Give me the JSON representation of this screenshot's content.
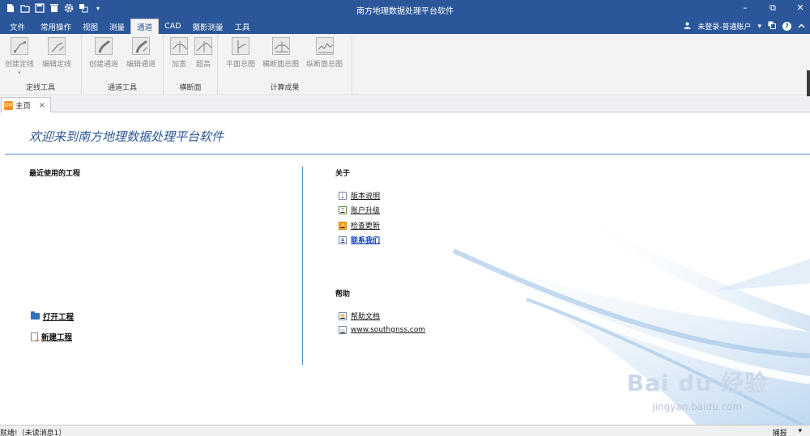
{
  "window": {
    "title": "南方地理数据处理平台软件",
    "minimize": "–",
    "restore": "⧉",
    "close": "✕"
  },
  "qat": [
    "new-file-icon",
    "open-folder-icon",
    "save-icon",
    "delete-icon",
    "settings-icon",
    "layers-icon",
    "dropdown-icon"
  ],
  "menubar": {
    "items": [
      "文件",
      "常用操作",
      "视图",
      "测量",
      "通道",
      "CAD",
      "摄影测量",
      "工具"
    ],
    "active": "通道",
    "account": "未登录-普通账户",
    "account_caret": "▾",
    "help": "?"
  },
  "ribbon": {
    "groups": [
      {
        "label": "定线工具",
        "buttons": [
          "创建定线",
          "编辑定线"
        ]
      },
      {
        "label": "通道工具",
        "buttons": [
          "创建通道",
          "编辑通道"
        ]
      },
      {
        "label": "横断面",
        "buttons": [
          "加宽",
          "超高"
        ]
      },
      {
        "label": "计算成果",
        "buttons": [
          "平面总图",
          "横断面总图",
          "纵断面总图"
        ]
      }
    ]
  },
  "tabs": {
    "home_icon": "HOME",
    "home_label": "主页",
    "close": "×"
  },
  "home": {
    "welcome": "欢迎来到南方地理数据处理平台软件",
    "recent_title": "最近使用的工程",
    "open_project": "打开工程",
    "new_project": "新建工程",
    "about_title": "关于",
    "about_links": [
      "版本说明",
      "账户升级",
      "检查更新",
      "联系我们"
    ],
    "help_title": "帮助",
    "help_links": [
      "帮助文档",
      "www.southgnss.com"
    ]
  },
  "watermark": {
    "brand": "Bai du 经验",
    "url": "jingyan.baidu.com"
  },
  "status": {
    "left": "就绪!（未读消息1）",
    "right": "捕报",
    "caret": "▾"
  },
  "colors": {
    "title_bar": "#2b579a",
    "ribbon_bg": "#f3f3f3",
    "accent_line": "#4f8fcf",
    "link_blue": "#0b3cc1"
  }
}
